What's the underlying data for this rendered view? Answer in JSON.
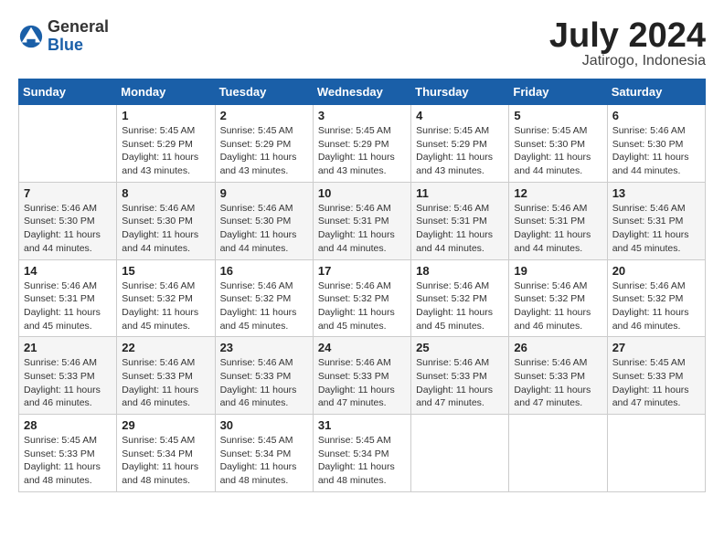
{
  "logo": {
    "general": "General",
    "blue": "Blue"
  },
  "title": {
    "month_year": "July 2024",
    "location": "Jatirogo, Indonesia"
  },
  "weekdays": [
    "Sunday",
    "Monday",
    "Tuesday",
    "Wednesday",
    "Thursday",
    "Friday",
    "Saturday"
  ],
  "weeks": [
    [
      {
        "day": "",
        "info": ""
      },
      {
        "day": "1",
        "info": "Sunrise: 5:45 AM\nSunset: 5:29 PM\nDaylight: 11 hours\nand 43 minutes."
      },
      {
        "day": "2",
        "info": "Sunrise: 5:45 AM\nSunset: 5:29 PM\nDaylight: 11 hours\nand 43 minutes."
      },
      {
        "day": "3",
        "info": "Sunrise: 5:45 AM\nSunset: 5:29 PM\nDaylight: 11 hours\nand 43 minutes."
      },
      {
        "day": "4",
        "info": "Sunrise: 5:45 AM\nSunset: 5:29 PM\nDaylight: 11 hours\nand 43 minutes."
      },
      {
        "day": "5",
        "info": "Sunrise: 5:45 AM\nSunset: 5:30 PM\nDaylight: 11 hours\nand 44 minutes."
      },
      {
        "day": "6",
        "info": "Sunrise: 5:46 AM\nSunset: 5:30 PM\nDaylight: 11 hours\nand 44 minutes."
      }
    ],
    [
      {
        "day": "7",
        "info": "Sunrise: 5:46 AM\nSunset: 5:30 PM\nDaylight: 11 hours\nand 44 minutes."
      },
      {
        "day": "8",
        "info": "Sunrise: 5:46 AM\nSunset: 5:30 PM\nDaylight: 11 hours\nand 44 minutes."
      },
      {
        "day": "9",
        "info": "Sunrise: 5:46 AM\nSunset: 5:30 PM\nDaylight: 11 hours\nand 44 minutes."
      },
      {
        "day": "10",
        "info": "Sunrise: 5:46 AM\nSunset: 5:31 PM\nDaylight: 11 hours\nand 44 minutes."
      },
      {
        "day": "11",
        "info": "Sunrise: 5:46 AM\nSunset: 5:31 PM\nDaylight: 11 hours\nand 44 minutes."
      },
      {
        "day": "12",
        "info": "Sunrise: 5:46 AM\nSunset: 5:31 PM\nDaylight: 11 hours\nand 44 minutes."
      },
      {
        "day": "13",
        "info": "Sunrise: 5:46 AM\nSunset: 5:31 PM\nDaylight: 11 hours\nand 45 minutes."
      }
    ],
    [
      {
        "day": "14",
        "info": "Sunrise: 5:46 AM\nSunset: 5:31 PM\nDaylight: 11 hours\nand 45 minutes."
      },
      {
        "day": "15",
        "info": "Sunrise: 5:46 AM\nSunset: 5:32 PM\nDaylight: 11 hours\nand 45 minutes."
      },
      {
        "day": "16",
        "info": "Sunrise: 5:46 AM\nSunset: 5:32 PM\nDaylight: 11 hours\nand 45 minutes."
      },
      {
        "day": "17",
        "info": "Sunrise: 5:46 AM\nSunset: 5:32 PM\nDaylight: 11 hours\nand 45 minutes."
      },
      {
        "day": "18",
        "info": "Sunrise: 5:46 AM\nSunset: 5:32 PM\nDaylight: 11 hours\nand 45 minutes."
      },
      {
        "day": "19",
        "info": "Sunrise: 5:46 AM\nSunset: 5:32 PM\nDaylight: 11 hours\nand 46 minutes."
      },
      {
        "day": "20",
        "info": "Sunrise: 5:46 AM\nSunset: 5:32 PM\nDaylight: 11 hours\nand 46 minutes."
      }
    ],
    [
      {
        "day": "21",
        "info": "Sunrise: 5:46 AM\nSunset: 5:33 PM\nDaylight: 11 hours\nand 46 minutes."
      },
      {
        "day": "22",
        "info": "Sunrise: 5:46 AM\nSunset: 5:33 PM\nDaylight: 11 hours\nand 46 minutes."
      },
      {
        "day": "23",
        "info": "Sunrise: 5:46 AM\nSunset: 5:33 PM\nDaylight: 11 hours\nand 46 minutes."
      },
      {
        "day": "24",
        "info": "Sunrise: 5:46 AM\nSunset: 5:33 PM\nDaylight: 11 hours\nand 47 minutes."
      },
      {
        "day": "25",
        "info": "Sunrise: 5:46 AM\nSunset: 5:33 PM\nDaylight: 11 hours\nand 47 minutes."
      },
      {
        "day": "26",
        "info": "Sunrise: 5:46 AM\nSunset: 5:33 PM\nDaylight: 11 hours\nand 47 minutes."
      },
      {
        "day": "27",
        "info": "Sunrise: 5:45 AM\nSunset: 5:33 PM\nDaylight: 11 hours\nand 47 minutes."
      }
    ],
    [
      {
        "day": "28",
        "info": "Sunrise: 5:45 AM\nSunset: 5:33 PM\nDaylight: 11 hours\nand 48 minutes."
      },
      {
        "day": "29",
        "info": "Sunrise: 5:45 AM\nSunset: 5:34 PM\nDaylight: 11 hours\nand 48 minutes."
      },
      {
        "day": "30",
        "info": "Sunrise: 5:45 AM\nSunset: 5:34 PM\nDaylight: 11 hours\nand 48 minutes."
      },
      {
        "day": "31",
        "info": "Sunrise: 5:45 AM\nSunset: 5:34 PM\nDaylight: 11 hours\nand 48 minutes."
      },
      {
        "day": "",
        "info": ""
      },
      {
        "day": "",
        "info": ""
      },
      {
        "day": "",
        "info": ""
      }
    ]
  ]
}
